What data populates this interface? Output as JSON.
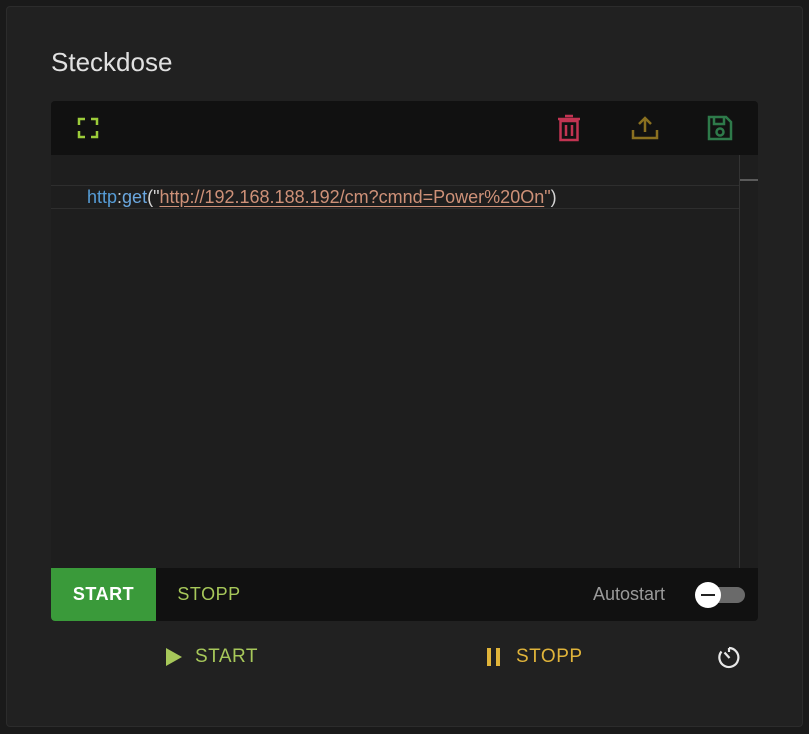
{
  "card": {
    "title": "Steckdose"
  },
  "toolbar": {
    "fullscreen_icon": "fullscreen-icon",
    "delete_icon": "trash-icon",
    "upload_icon": "upload-icon",
    "save_icon": "floppy-save-icon",
    "colors": {
      "fullscreen": "#9ccc3a",
      "delete": "#c23452",
      "upload": "#8a7020",
      "save": "#2e7a4a"
    }
  },
  "editor": {
    "code": {
      "ns": "http",
      "colon": ":",
      "fn": "get",
      "open": "(\"",
      "url": "http://192.168.188.192/cm?cmnd=Power%20On",
      "close_quote": "\"",
      "close_paren": ")"
    }
  },
  "footer": {
    "start_label": "START",
    "stopp_label": "STOPP",
    "autostart_label": "Autostart",
    "autostart_on": false,
    "colors": {
      "start_bg": "#3a9a3a",
      "stopp_text": "#a7c85a"
    }
  },
  "controls": {
    "start_label": "START",
    "stopp_label": "STOPP",
    "play_icon": "play-icon",
    "pause_icon": "pause-icon",
    "timer_icon": "timer-icon"
  }
}
